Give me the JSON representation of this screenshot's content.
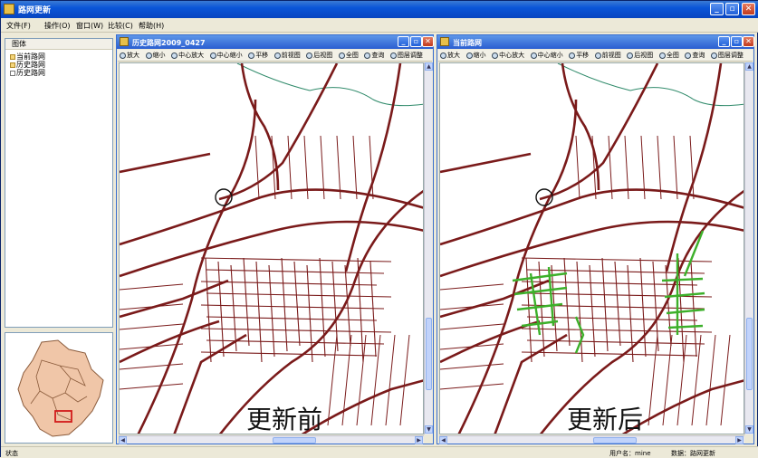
{
  "window": {
    "title": "路网更新"
  },
  "menu": [
    "文件(F)",
    "操作(O)",
    "窗口(W)",
    "比较(C)",
    "帮助(H)"
  ],
  "layers": {
    "header": "图体",
    "items": [
      "当前路网",
      "历史路网",
      "历史路网"
    ]
  },
  "left_window": {
    "title": "历史路网2009_0427",
    "toolbar": [
      "放大",
      "缩小",
      "中心放大",
      "中心缩小",
      "平移",
      "前视图",
      "后视图",
      "全图",
      "查询",
      "图层调整"
    ],
    "label": "更新前"
  },
  "right_window": {
    "title": "当前路网",
    "toolbar": [
      "放大",
      "缩小",
      "中心放大",
      "中心缩小",
      "平移",
      "前视图",
      "后视图",
      "全图",
      "查询",
      "图层调整"
    ],
    "label": "更新后"
  },
  "status": {
    "left": "状态",
    "user": "用户名：mine",
    "data": "数据：路网更新"
  },
  "colors": {
    "road": "#7a1a1a",
    "new_road": "#3cb02a",
    "river": "#2f8a6a",
    "titlebar": "#0a55d8"
  }
}
